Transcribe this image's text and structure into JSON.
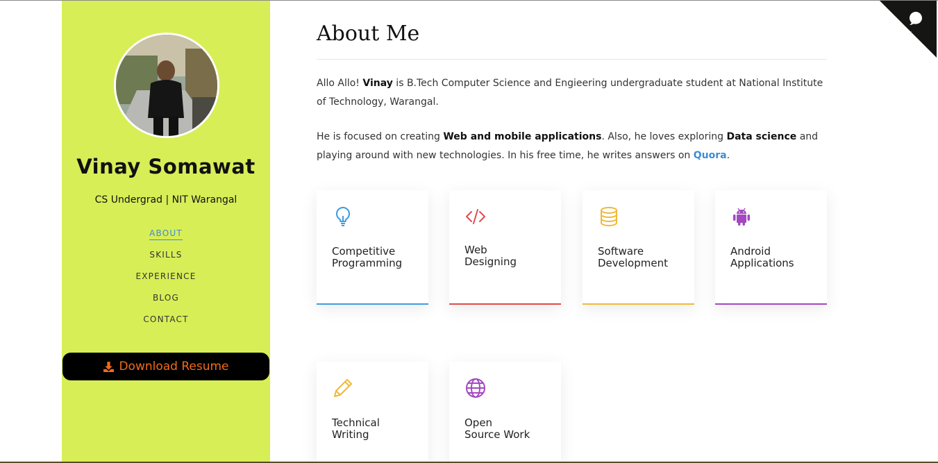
{
  "sidebar": {
    "name": "Vinay Somawat",
    "tagline": "CS Undergrad | NIT Warangal",
    "nav": [
      {
        "label": "ABOUT",
        "active": true
      },
      {
        "label": "SKILLS",
        "active": false
      },
      {
        "label": "EXPERIENCE",
        "active": false
      },
      {
        "label": "BLOG",
        "active": false
      },
      {
        "label": "CONTACT",
        "active": false
      }
    ],
    "resume_button": "Download Resume",
    "background_color": "#d8ee57",
    "button_text_color": "#f26a1b"
  },
  "main": {
    "title": "About Me",
    "paragraph1": {
      "t1": "Allo Allo! ",
      "b1": "Vinay",
      "t2": " is B.Tech Computer Science and Engieering undergraduate student at National Institute of Technology, Warangal."
    },
    "paragraph2": {
      "t1": "He is focused on creating ",
      "b1": "Web and mobile applications",
      "t2": ". Also, he loves exploring ",
      "b2": "Data science",
      "t3": " and playing around with new technologies. In his free time, he writes answers on ",
      "link": "Quora",
      "t4": "."
    },
    "cards": [
      {
        "line1": "Competitive",
        "line2": "Programming",
        "icon": "lightbulb-icon",
        "color": "#3d9ce0"
      },
      {
        "line1": "Web",
        "line2": "Designing",
        "icon": "code-icon",
        "color": "#e04b4b"
      },
      {
        "line1": "Software",
        "line2": "Development",
        "icon": "database-icon",
        "color": "#f0b93a"
      },
      {
        "line1": "Android",
        "line2": "Applications",
        "icon": "android-icon",
        "color": "#a348c0"
      },
      {
        "line1": "Technical",
        "line2": "Writing",
        "icon": "pencil-icon",
        "color": "#f0b93a"
      },
      {
        "line1": "Open",
        "line2": "Source Work",
        "icon": "globe-icon",
        "color": "#a348c0"
      }
    ]
  },
  "github_corner": {
    "icon": "github-octocat-icon"
  }
}
